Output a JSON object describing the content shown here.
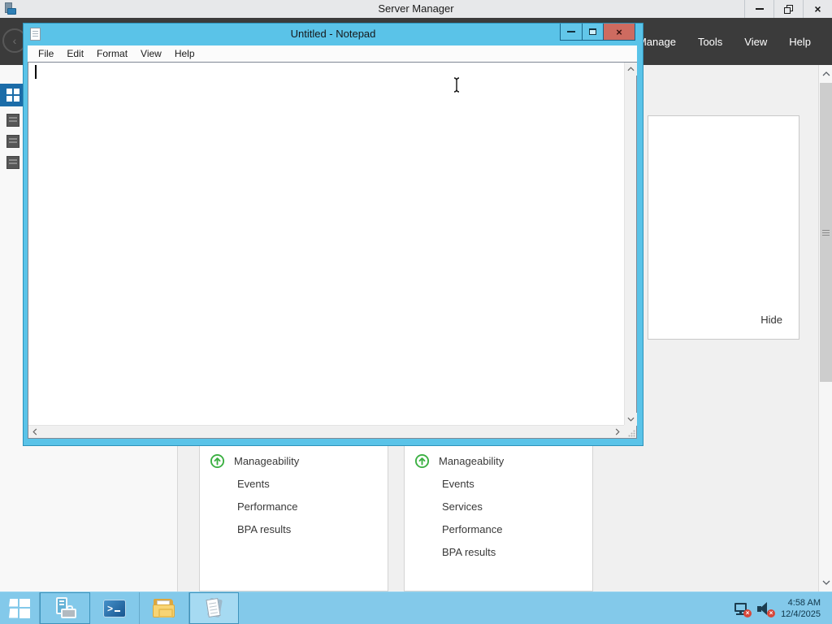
{
  "colors": {
    "accent_cyan": "#5ac3e8",
    "taskbar_blue": "#83c9ea",
    "dark_header": "#3b3b3b",
    "nav_selected_blue": "#1b6ca8",
    "close_button_red": "#ce6b60",
    "status_green": "#3cb043",
    "content_gray": "#f0f0f0"
  },
  "icons": {
    "close_glyph": "×",
    "back_glyph": "‹",
    "powershell_glyph": ">"
  },
  "server_manager": {
    "title": "Server Manager",
    "menu": [
      "Manage",
      "Tools",
      "View",
      "Help"
    ],
    "welcome_tile": {
      "hide": "Hide"
    },
    "tiles": [
      {
        "heading": "Manageability",
        "links": [
          "Events",
          "Performance",
          "BPA results"
        ]
      },
      {
        "heading": "Manageability",
        "links": [
          "Events",
          "Services",
          "Performance",
          "BPA results"
        ]
      }
    ]
  },
  "notepad": {
    "title": "Untitled - Notepad",
    "menu": [
      "File",
      "Edit",
      "Format",
      "View",
      "Help"
    ],
    "text": ""
  },
  "taskbar": {
    "clock": {
      "time": "4:58 AM",
      "date": "12/4/2025"
    }
  }
}
